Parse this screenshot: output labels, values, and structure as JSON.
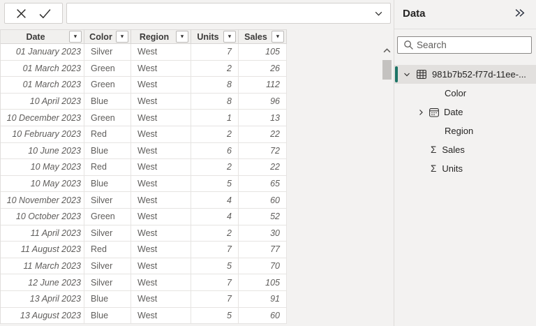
{
  "colors": {
    "chrome_bg": "#f3f2f1",
    "accent_teal": "#1c7466",
    "selected_row_bg": "#e2e0de",
    "cell_text": "#5f5d5b",
    "header_text": "#3b3a39"
  },
  "topbar": {
    "formula_value": ""
  },
  "table": {
    "columns": [
      {
        "key": "date",
        "label": "Date"
      },
      {
        "key": "color",
        "label": "Color"
      },
      {
        "key": "region",
        "label": "Region"
      },
      {
        "key": "units",
        "label": "Units"
      },
      {
        "key": "sales",
        "label": "Sales"
      }
    ],
    "rows": [
      [
        "01 January 2023",
        "Silver",
        "West",
        7,
        105
      ],
      [
        "01 March 2023",
        "Green",
        "West",
        2,
        26
      ],
      [
        "01 March 2023",
        "Green",
        "West",
        8,
        112
      ],
      [
        "10 April 2023",
        "Blue",
        "West",
        8,
        96
      ],
      [
        "10 December 2023",
        "Green",
        "West",
        1,
        13
      ],
      [
        "10 February 2023",
        "Red",
        "West",
        2,
        22
      ],
      [
        "10 June 2023",
        "Blue",
        "West",
        6,
        72
      ],
      [
        "10 May 2023",
        "Red",
        "West",
        2,
        22
      ],
      [
        "10 May 2023",
        "Blue",
        "West",
        5,
        65
      ],
      [
        "10 November 2023",
        "Silver",
        "West",
        4,
        60
      ],
      [
        "10 October 2023",
        "Green",
        "West",
        4,
        52
      ],
      [
        "11 April 2023",
        "Silver",
        "West",
        2,
        30
      ],
      [
        "11 August 2023",
        "Red",
        "West",
        7,
        77
      ],
      [
        "11 March 2023",
        "Silver",
        "West",
        5,
        70
      ],
      [
        "12 June 2023",
        "Silver",
        "West",
        7,
        105
      ],
      [
        "13 April 2023",
        "Blue",
        "West",
        7,
        91
      ],
      [
        "13 August 2023",
        "Blue",
        "West",
        5,
        60
      ]
    ]
  },
  "side_panel": {
    "title": "Data",
    "search_placeholder": "Search",
    "table_item": {
      "name": "981b7b52-f77d-11ee-..."
    },
    "fields": [
      {
        "label": "Color",
        "icon": null,
        "expandable": false
      },
      {
        "label": "Date",
        "icon": "calendar",
        "expandable": true
      },
      {
        "label": "Region",
        "icon": null,
        "expandable": false
      },
      {
        "label": "Sales",
        "icon": "sigma",
        "expandable": false
      },
      {
        "label": "Units",
        "icon": "sigma",
        "expandable": false
      }
    ]
  },
  "glyphs": {
    "sigma": "Σ",
    "filter_arrow": "▼"
  }
}
